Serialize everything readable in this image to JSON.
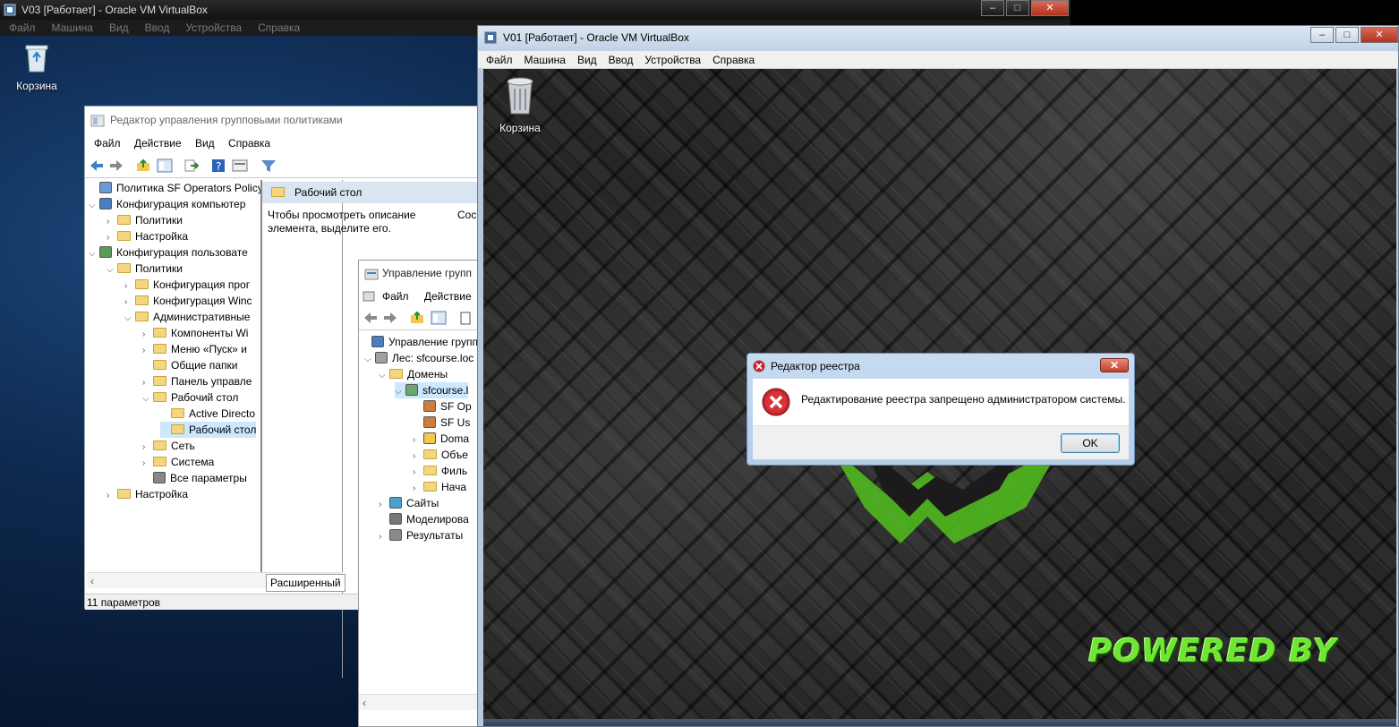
{
  "v03": {
    "title": "V03 [Работает] - Oracle VM VirtualBox",
    "menu": [
      "Файл",
      "Машина",
      "Вид",
      "Ввод",
      "Устройства",
      "Справка"
    ],
    "recycle_label": "Корзина",
    "window_buttons": [
      "–",
      "□",
      "✕"
    ]
  },
  "gpo_editor": {
    "title": "Редактор управления групповыми политиками",
    "menu": [
      "Файл",
      "Действие",
      "Вид",
      "Справка"
    ],
    "tree": [
      {
        "label": "Политика SF Operators Policy [",
        "arrow": "",
        "icon": "policy"
      },
      {
        "label": "Конфигурация компьютер",
        "arrow": "⌄",
        "icon": "computer"
      },
      {
        "label": "Политики",
        "arrow": "›",
        "icon": "folder"
      },
      {
        "label": "Настройка",
        "arrow": "›",
        "icon": "folder"
      },
      {
        "label": "Конфигурация пользовате",
        "arrow": "⌄",
        "icon": "user"
      },
      {
        "label": "Политики",
        "arrow": "⌄",
        "icon": "folder"
      },
      {
        "label": "Конфигурация прог",
        "arrow": "›",
        "icon": "folder"
      },
      {
        "label": "Конфигурация Winc",
        "arrow": "›",
        "icon": "folder"
      },
      {
        "label": "Административные",
        "arrow": "⌄",
        "icon": "folder"
      },
      {
        "label": "Компоненты Wi",
        "arrow": "›",
        "icon": "folder"
      },
      {
        "label": "Меню «Пуск» и",
        "arrow": "›",
        "icon": "folder"
      },
      {
        "label": "Общие папки",
        "arrow": "",
        "icon": "folder"
      },
      {
        "label": "Панель управле",
        "arrow": "›",
        "icon": "folder"
      },
      {
        "label": "Рабочий стол",
        "arrow": "⌄",
        "icon": "folder"
      },
      {
        "label": "Active Directo",
        "arrow": "",
        "icon": "folder"
      },
      {
        "label": "Рабочий стол",
        "arrow": "",
        "icon": "folder"
      },
      {
        "label": "Сеть",
        "arrow": "›",
        "icon": "folder"
      },
      {
        "label": "Система",
        "arrow": "›",
        "icon": "folder"
      },
      {
        "label": "Все параметры",
        "arrow": "",
        "icon": "settings"
      },
      {
        "label": "Настройка",
        "arrow": "›",
        "icon": "folder"
      }
    ],
    "right_header": "Рабочий стол",
    "right_desc": "Чтобы просмотреть описание элемента, выделите его.",
    "right_col": "Сос",
    "tab_label": "Расширенный",
    "status": "11 параметров"
  },
  "gpm": {
    "title": "Управление групп",
    "menu": [
      "Файл",
      "Действие"
    ],
    "tree": [
      {
        "label": "Управление групп",
        "arrow": "",
        "icon": "gpm"
      },
      {
        "label": "Лес: sfcourse.loc",
        "arrow": "⌄",
        "icon": "forest"
      },
      {
        "label": "Домены",
        "arrow": "⌄",
        "icon": "folder"
      },
      {
        "label": "sfcourse.l",
        "arrow": "⌄",
        "icon": "domain"
      },
      {
        "label": "SF Op",
        "arrow": "",
        "icon": "gpo"
      },
      {
        "label": "SF Us",
        "arrow": "",
        "icon": "gpo"
      },
      {
        "label": "Doma",
        "arrow": "›",
        "icon": "ou"
      },
      {
        "label": "Объе",
        "arrow": "›",
        "icon": "folder"
      },
      {
        "label": "Филь",
        "arrow": "›",
        "icon": "folder"
      },
      {
        "label": "Нача",
        "arrow": "›",
        "icon": "folder"
      },
      {
        "label": "Сайты",
        "arrow": "›",
        "icon": "sites"
      },
      {
        "label": "Моделирова",
        "arrow": "",
        "icon": "model"
      },
      {
        "label": "Результаты",
        "arrow": "›",
        "icon": "results"
      }
    ]
  },
  "v01": {
    "title": "V01 [Работает] - Oracle VM VirtualBox",
    "menu": [
      "Файл",
      "Машина",
      "Вид",
      "Ввод",
      "Устройства",
      "Справка"
    ],
    "recycle_label": "Корзина",
    "window_buttons": [
      "–",
      "□",
      "✕"
    ],
    "wallpaper_text": "POWERED BY"
  },
  "dialog": {
    "title": "Редактор реестра",
    "message": "Редактирование реестра запрещено администратором системы.",
    "ok_label": "OK",
    "close_label": "✕"
  },
  "colors": {
    "accent_green": "#6fe632",
    "selection": "#cce8ff",
    "error_red": "#c1272d"
  }
}
